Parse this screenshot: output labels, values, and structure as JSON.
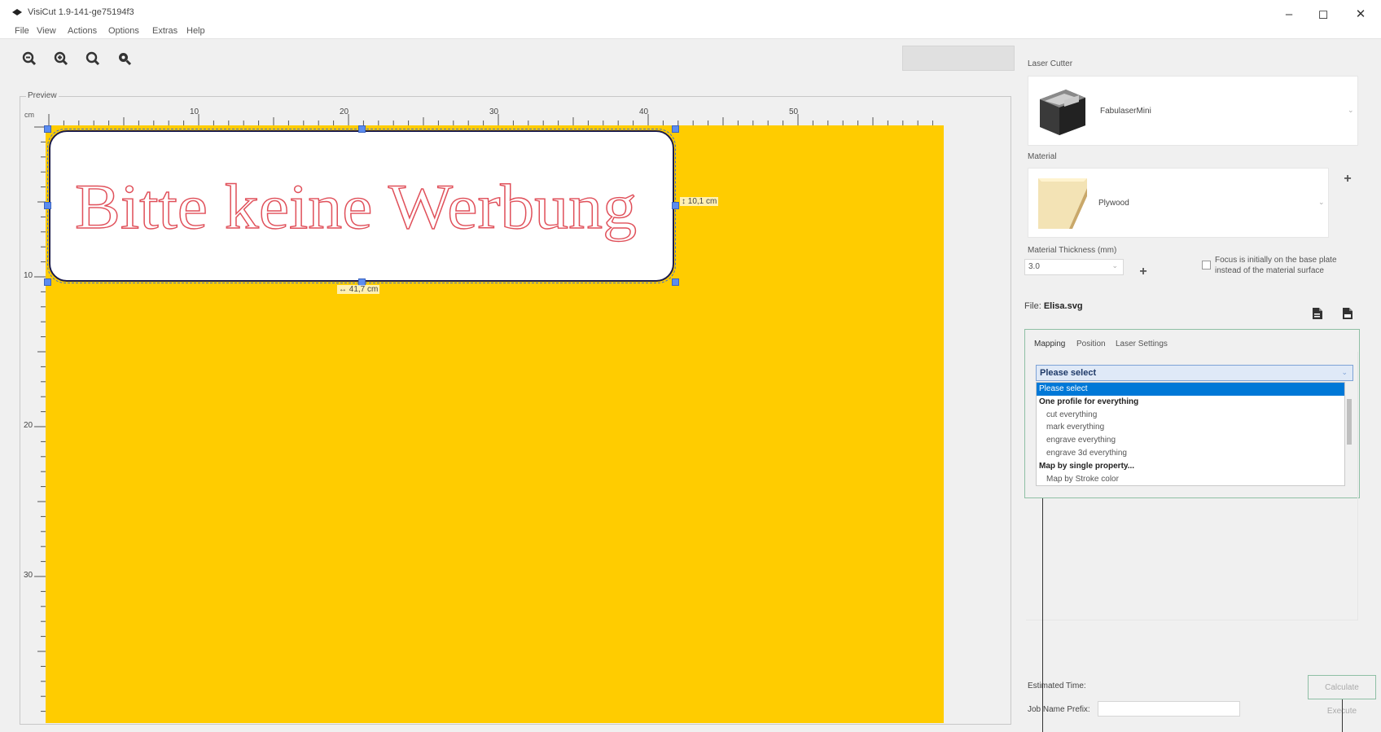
{
  "window": {
    "title": "VisiCut 1.9-141-ge75194f3",
    "controls": {
      "minimize": "–",
      "maximize": "◻",
      "close": "✕"
    }
  },
  "menu": {
    "items": [
      {
        "label": "File"
      },
      {
        "label": "View"
      },
      {
        "label": "Actions"
      },
      {
        "label": "Options"
      },
      {
        "label": "Extras"
      },
      {
        "label": "Help"
      }
    ]
  },
  "toolbar": {
    "buttons": [
      {
        "icon": "zoom-out-icon"
      },
      {
        "icon": "zoom-in-icon"
      },
      {
        "icon": "zoom-fit-icon"
      },
      {
        "icon": "zoom-reset-icon"
      }
    ]
  },
  "preview": {
    "label": "Preview",
    "unit": "cm",
    "ruler_top_labels": [
      "10",
      "20",
      "30",
      "40",
      "50"
    ],
    "ruler_left_labels": [
      "10",
      "20",
      "30"
    ],
    "sign_text": "Bitte keine Werbung",
    "height_label": "↕ 10,1 cm",
    "width_label": "↔ 41,7 cm",
    "colors": {
      "bed": "#ffcc00",
      "outline": "#e0505a",
      "selection": "#3b6cd4"
    }
  },
  "laser_cutter": {
    "label": "Laser Cutter",
    "value": "FabulaserMini",
    "icon": "laser-cutter-machine-icon"
  },
  "material": {
    "label": "Material",
    "value": "Plywood",
    "icon": "plywood-swatch-icon",
    "add": "+"
  },
  "thickness": {
    "label": "Material Thickness (mm)",
    "value": "3.0",
    "add": "+",
    "focus_text": "Focus is initially on the base plate instead of the material surface",
    "focus_checked": false
  },
  "file": {
    "prefix": "File:",
    "name": "Elisa.svg"
  },
  "tabs": [
    {
      "label": "Mapping",
      "active": true
    },
    {
      "label": "Position",
      "active": false
    },
    {
      "label": "Laser Settings",
      "active": false
    }
  ],
  "mapping": {
    "selected": "Please select",
    "options": [
      {
        "label": "Please select",
        "kind": "selected"
      },
      {
        "label": "One profile for everything",
        "kind": "header"
      },
      {
        "label": "cut everything",
        "kind": "item"
      },
      {
        "label": "mark everything",
        "kind": "item"
      },
      {
        "label": "engrave everything",
        "kind": "item"
      },
      {
        "label": "engrave 3d everything",
        "kind": "item"
      },
      {
        "label": "Map by single property...",
        "kind": "header"
      },
      {
        "label": "Map by Stroke color",
        "kind": "item"
      }
    ]
  },
  "footer": {
    "estimated_time_label": "Estimated Time:",
    "job_prefix_label": "Job Name Prefix:",
    "job_prefix_value": "",
    "calculate": "Calculate",
    "execute": "Execute"
  }
}
